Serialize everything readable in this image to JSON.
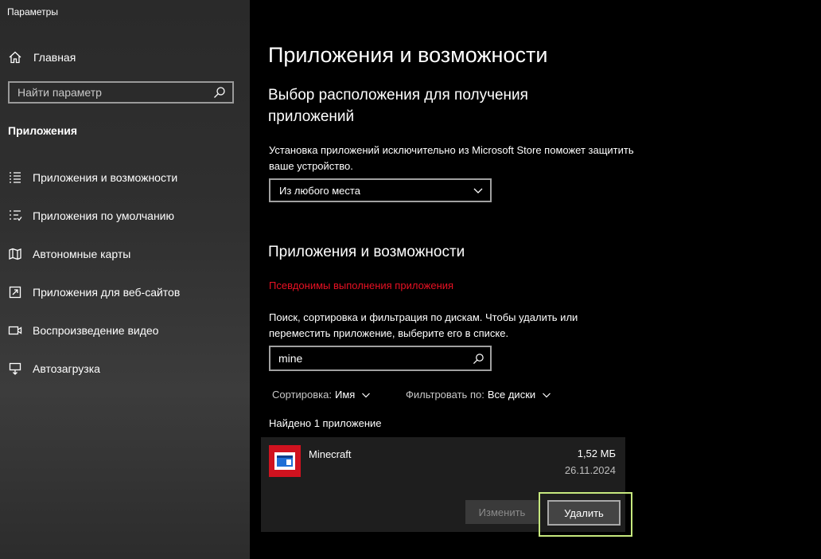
{
  "window": {
    "title": "Параметры"
  },
  "sidebar": {
    "home_label": "Главная",
    "search_placeholder": "Найти параметр",
    "section_title": "Приложения",
    "items": [
      {
        "label": "Приложения и возможности",
        "icon": "apps-list-icon"
      },
      {
        "label": "Приложения по умолчанию",
        "icon": "default-apps-icon"
      },
      {
        "label": "Автономные карты",
        "icon": "map-icon"
      },
      {
        "label": "Приложения для веб-сайтов",
        "icon": "web-apps-icon"
      },
      {
        "label": "Воспроизведение видео",
        "icon": "video-icon"
      },
      {
        "label": "Автозагрузка",
        "icon": "startup-icon"
      }
    ]
  },
  "main": {
    "title": "Приложения и возможности",
    "location_title": "Выбор расположения для получения приложений",
    "location_desc": "Установка приложений исключительно из Microsoft Store поможет защитить ваше устройство.",
    "location_value": "Из любого места",
    "apps_title": "Приложения и возможности",
    "alias_link": "Псевдонимы выполнения приложения",
    "search_desc": "Поиск, сортировка и фильтрация по дискам. Чтобы удалить или переместить приложение, выберите его в списке.",
    "search_value": "mine",
    "sort_label": "Сортировка:",
    "sort_value": "Имя",
    "filter_label": "Фильтровать по:",
    "filter_value": "Все диски",
    "found_text": "Найдено 1 приложение",
    "app": {
      "name": "Minecraft",
      "size": "1,52 МБ",
      "date": "26.11.2024",
      "modify_label": "Изменить",
      "uninstall_label": "Удалить"
    }
  },
  "colors": {
    "accent_link": "#e81123",
    "highlight": "#c6e87e",
    "app_icon_bg": "#d0121f"
  }
}
